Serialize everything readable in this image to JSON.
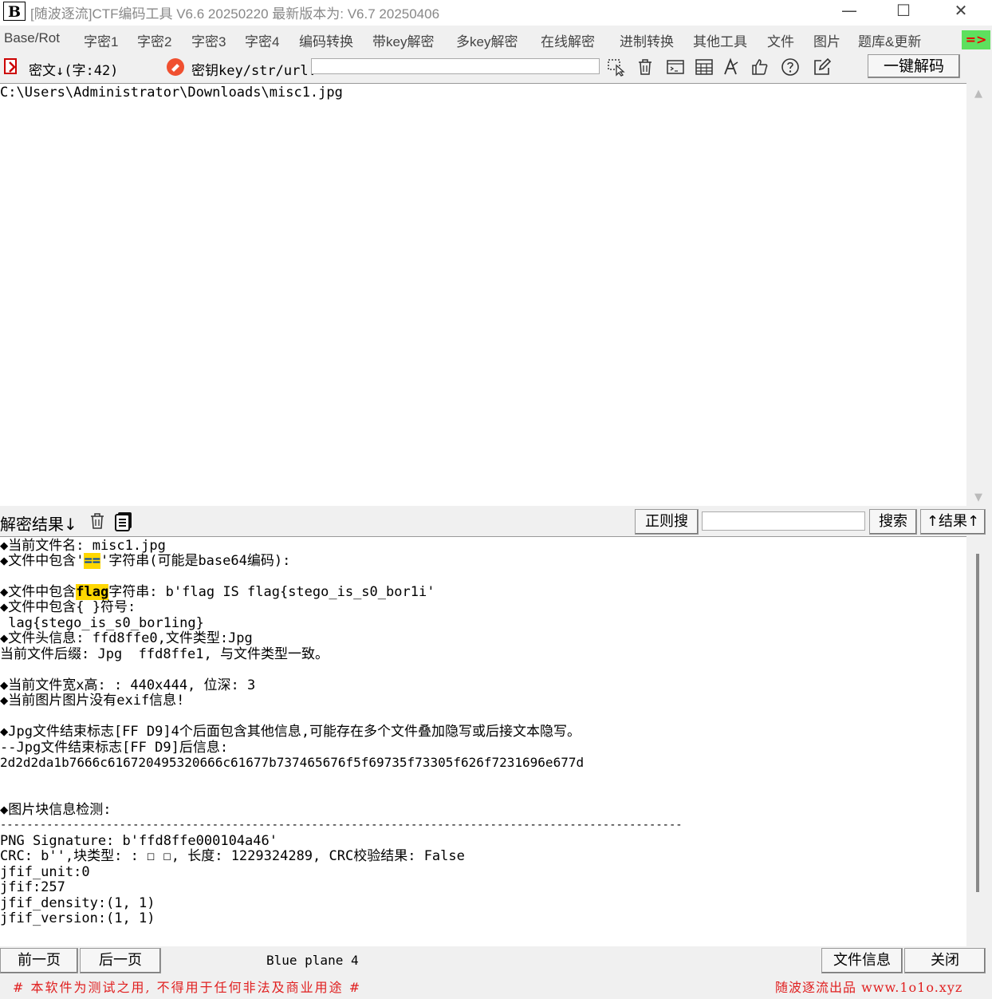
{
  "window": {
    "logo": "B",
    "title": "[随波逐流]CTF编码工具 V6.6 20250220    最新版本为: V6.7 20250406",
    "minimize": "—",
    "maximize": "☐",
    "close": "✕"
  },
  "menu": {
    "items": [
      "Base/Rot",
      "字密1",
      "字密2",
      "字密3",
      "字密4",
      "编码转换",
      "带key解密",
      "多key解密",
      "在线解密",
      "进制转换",
      "其他工具",
      "文件",
      "图片",
      "题库&更新"
    ],
    "green_button": "=>"
  },
  "toolbar": {
    "cipher_label": "密文↓(字:42)",
    "key_label": "密钥key/str/url:",
    "key_value": "",
    "decode_button": "一键解码",
    "icons": [
      "cursor-icon",
      "trash-icon",
      "terminal-icon",
      "calculator-icon",
      "font-icon",
      "thumbs-up-icon",
      "help-icon",
      "edit-icon"
    ]
  },
  "cipher": {
    "text": "C:\\Users\\Administrator\\Downloads\\misc1.jpg"
  },
  "result_header": {
    "label": "解密结果↓",
    "regex_button": "正则搜",
    "search_value": "",
    "search_button": "搜索",
    "result_up_button": "↑结果↑"
  },
  "result": {
    "l1": "◆当前文件名: misc1.jpg",
    "l2a": "◆文件中包含'",
    "l2b": "==",
    "l2c": "'字符串(可能是base64编码):",
    "l3a": "◆文件中包含",
    "l3b": "flag",
    "l3c": "字符串: b'flag IS flag{stego_is_s0_bor1i'",
    "l4": "◆文件中包含{ }符号:",
    "l5": " lag{stego_is_s0_bor1ing}",
    "l6": "◆文件头信息: ffd8ffe0,文件类型:Jpg",
    "l7": "当前文件后缀: Jpg  ffd8ffe1, 与文件类型一致。",
    "l8": "◆当前文件宽x高: : 440x444, 位深: 3",
    "l9": "◆当前图片图片没有exif信息!",
    "l10": "◆Jpg文件结束标志[FF D9]4个后面包含其他信息,可能存在多个文件叠加隐写或后接文本隐写。",
    "l11": "--Jpg文件结束标志[FF D9]后信息:",
    "l12": "2d2d2da1b7666c616720495320666c61677b737465676f5f69735f73305f626f7231696e677d",
    "l13": "◆图片块信息检测:",
    "l14": "-------------------------------------------------------------------------------------------------------",
    "l15": "PNG Signature: b'ffd8ffe000104a46'",
    "l16": "CRC: b'',块类型: : ☐ ☐, 长度: 1229324289, CRC校验结果: False",
    "l17": "jfif_unit:0",
    "l18": "jfif:257",
    "l19": "jfif_density:(1, 1)",
    "l20": "jfif_version:(1, 1)"
  },
  "bottom": {
    "prev_button": "前一页",
    "next_button": "后一页",
    "plane_label": "Blue plane 4",
    "file_info_button": "文件信息",
    "close_button": "关闭"
  },
  "footer": {
    "left": "# 本软件为测试之用, 不得用于任何非法及商业用途 #",
    "right": "随波逐流出品 www.1o1o.xyz"
  }
}
